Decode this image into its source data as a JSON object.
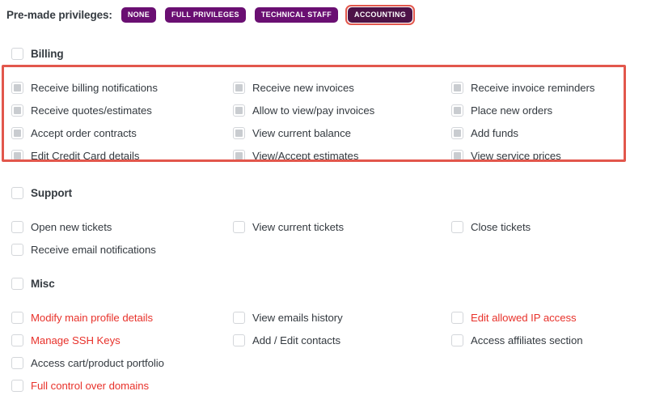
{
  "premade": {
    "label": "Pre-made privileges:",
    "badges": [
      {
        "label": "NONE",
        "style": "normal",
        "highlighted": false
      },
      {
        "label": "FULL PRIVILEGES",
        "style": "normal",
        "highlighted": false
      },
      {
        "label": "TECHNICAL STAFF",
        "style": "normal",
        "highlighted": false
      },
      {
        "label": "ACCOUNTING",
        "style": "dark",
        "highlighted": true
      }
    ],
    "badge_color": "#6a0f72",
    "badge_color_dark": "#4d1247",
    "highlight_color": "#e2574c"
  },
  "sections": [
    {
      "name": "Billing",
      "header_checked": false,
      "highlighted": true,
      "options": [
        {
          "label": "Receive billing notifications",
          "checked": true,
          "red": false,
          "col": 0,
          "row": 0
        },
        {
          "label": "Receive quotes/estimates",
          "checked": true,
          "red": false,
          "col": 0,
          "row": 1
        },
        {
          "label": "Accept order contracts",
          "checked": true,
          "red": false,
          "col": 0,
          "row": 2
        },
        {
          "label": "Edit Credit Card details",
          "checked": true,
          "red": false,
          "col": 0,
          "row": 3
        },
        {
          "label": "Receive new invoices",
          "checked": true,
          "red": false,
          "col": 1,
          "row": 0
        },
        {
          "label": "Allow to view/pay invoices",
          "checked": true,
          "red": false,
          "col": 1,
          "row": 1
        },
        {
          "label": "View current balance",
          "checked": true,
          "red": false,
          "col": 1,
          "row": 2
        },
        {
          "label": "View/Accept estimates",
          "checked": true,
          "red": false,
          "col": 1,
          "row": 3
        },
        {
          "label": "Receive invoice reminders",
          "checked": true,
          "red": false,
          "col": 2,
          "row": 0
        },
        {
          "label": "Place new orders",
          "checked": true,
          "red": false,
          "col": 2,
          "row": 1
        },
        {
          "label": "Add funds",
          "checked": true,
          "red": false,
          "col": 2,
          "row": 2
        },
        {
          "label": "View service prices",
          "checked": true,
          "red": false,
          "col": 2,
          "row": 3
        }
      ]
    },
    {
      "name": "Support",
      "header_checked": false,
      "highlighted": false,
      "options": [
        {
          "label": "Open new tickets",
          "checked": false,
          "red": false,
          "col": 0,
          "row": 0
        },
        {
          "label": "Receive email notifications",
          "checked": false,
          "red": false,
          "col": 0,
          "row": 1
        },
        {
          "label": "View current tickets",
          "checked": false,
          "red": false,
          "col": 1,
          "row": 0
        },
        {
          "label": "Close tickets",
          "checked": false,
          "red": false,
          "col": 2,
          "row": 0
        }
      ]
    },
    {
      "name": "Misc",
      "header_checked": false,
      "highlighted": false,
      "options": [
        {
          "label": "Modify main profile details",
          "checked": false,
          "red": true,
          "col": 0,
          "row": 0
        },
        {
          "label": "Manage SSH Keys",
          "checked": false,
          "red": true,
          "col": 0,
          "row": 1
        },
        {
          "label": "Access cart/product portfolio",
          "checked": false,
          "red": false,
          "col": 0,
          "row": 2
        },
        {
          "label": "Full control over domains",
          "checked": false,
          "red": true,
          "col": 0,
          "row": 3
        },
        {
          "label": "View emails history",
          "checked": false,
          "red": false,
          "col": 1,
          "row": 0
        },
        {
          "label": "Add / Edit contacts",
          "checked": false,
          "red": false,
          "col": 1,
          "row": 1
        },
        {
          "label": "Edit allowed IP access",
          "checked": false,
          "red": true,
          "col": 2,
          "row": 0
        },
        {
          "label": "Access affiliates section",
          "checked": false,
          "red": false,
          "col": 2,
          "row": 1
        }
      ]
    }
  ]
}
